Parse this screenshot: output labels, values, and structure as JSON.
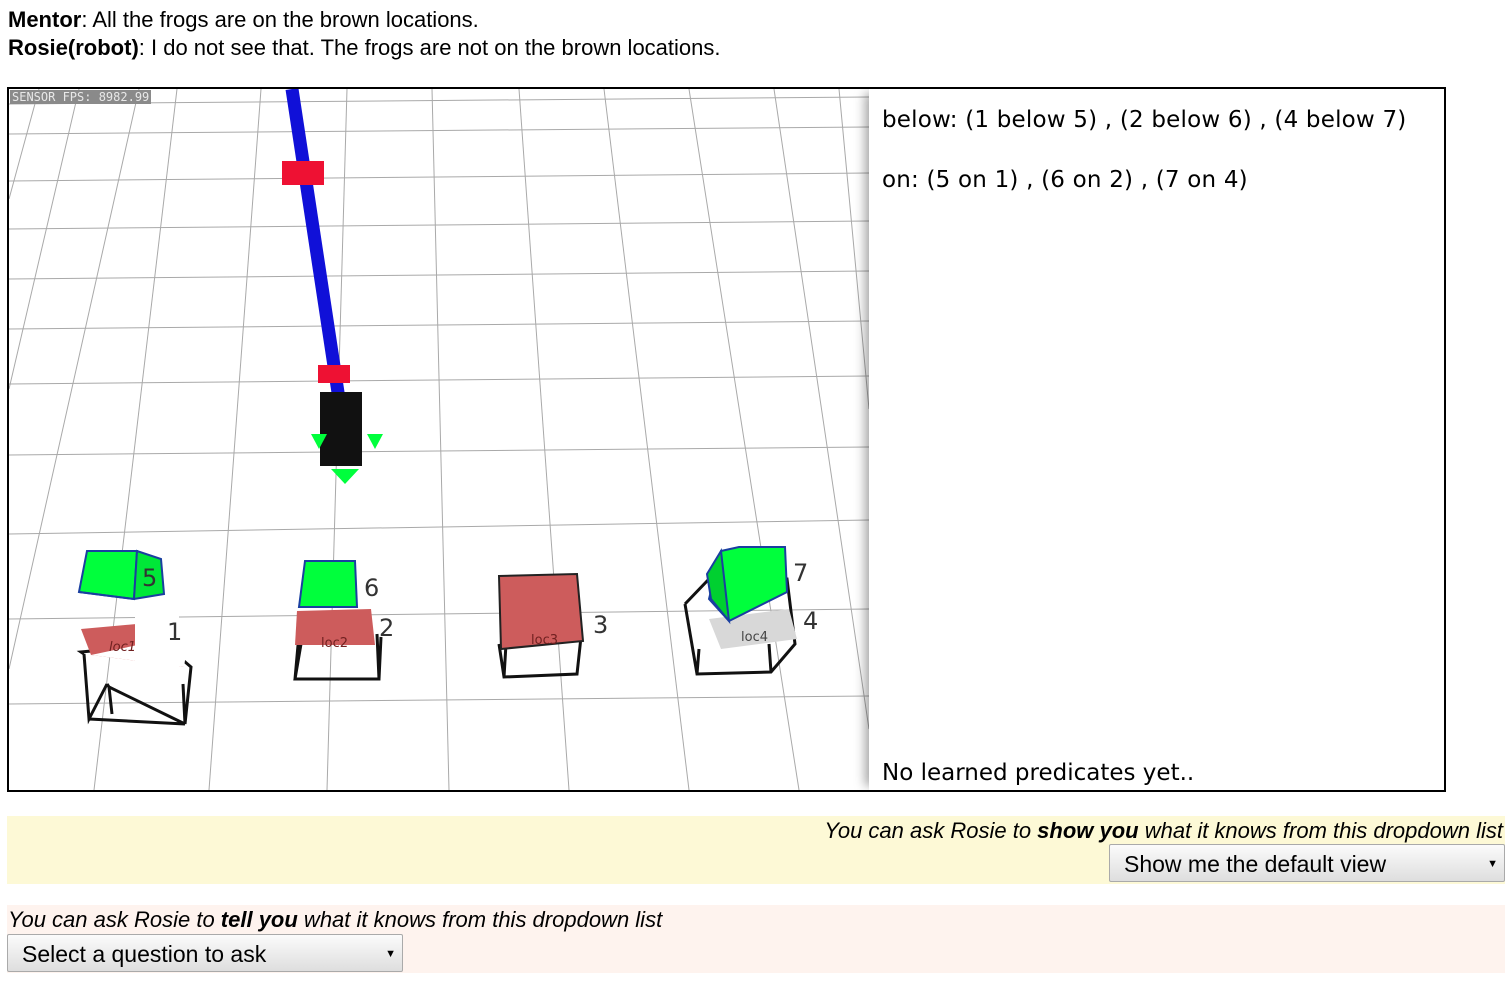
{
  "dialog": {
    "mentor_name": "Mentor",
    "mentor_text": ": All the frogs are on the brown locations.",
    "rosie_name": "Rosie(robot)",
    "rosie_text": ": I do not see that. The frogs are not on the brown locations."
  },
  "scene": {
    "fps_label": "SENSOR FPS: 8982.99",
    "locations": [
      "loc1",
      "loc2",
      "loc3",
      "loc4"
    ],
    "object_ids": [
      "1",
      "2",
      "3",
      "4",
      "5",
      "6",
      "7"
    ],
    "colors": {
      "brown": "#cd5c5c",
      "green": "#00ff3c",
      "arm_blue": "#1010d8",
      "arm_red": "#ee1133",
      "gray": "#d8d8d8"
    }
  },
  "info": {
    "below": "below: (1 below 5) , (2 below 6) , (4 below 7)",
    "on": "on: (5 on 1) , (6 on 2) , (7 on 4)",
    "learned": "No learned predicates yet.."
  },
  "show": {
    "label_pre": "You can ask Rosie to ",
    "label_bold": "show you",
    "label_post": " what it knows from this dropdown list",
    "selected": "Show me the default view"
  },
  "tell": {
    "label_pre": "You can ask Rosie to ",
    "label_bold": "tell you",
    "label_post": " what it knows from this dropdown list",
    "selected": "Select a question to ask"
  }
}
